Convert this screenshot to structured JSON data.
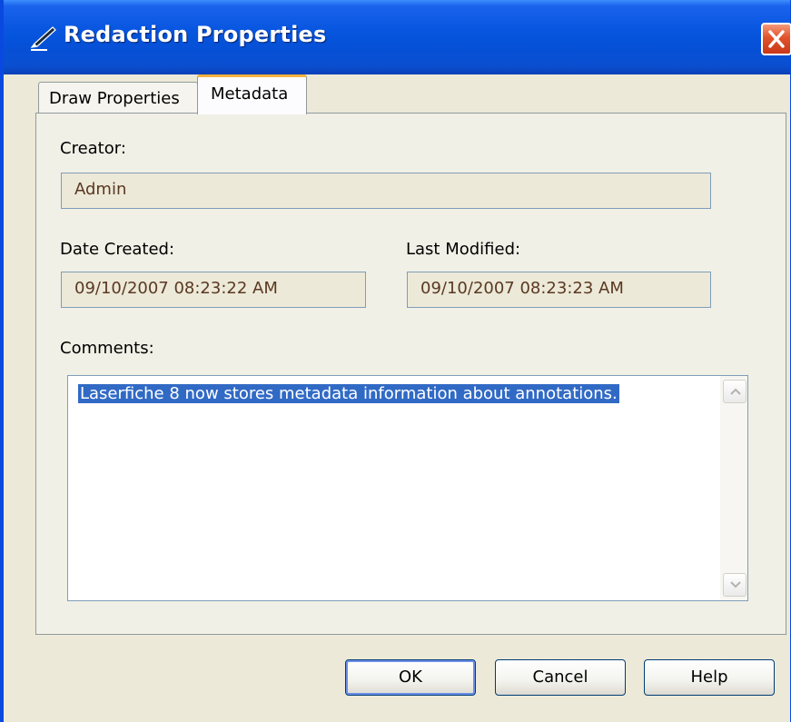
{
  "window": {
    "title": "Redaction Properties",
    "icons": {
      "title": "pen-icon",
      "close": "close-x-icon"
    }
  },
  "tabs": [
    {
      "label": "Draw Properties",
      "active": false
    },
    {
      "label": "Metadata",
      "active": true
    }
  ],
  "metadata": {
    "creator_label": "Creator:",
    "creator_value": "Admin",
    "date_created_label": "Date Created:",
    "date_created_value": "09/10/2007 08:23:22 AM",
    "last_modified_label": "Last Modified:",
    "last_modified_value": "09/10/2007 08:23:23 AM",
    "comments_label": "Comments:",
    "comments_value": "Laserfiche 8 now stores metadata information about annotations."
  },
  "buttons": {
    "ok": "OK",
    "cancel": "Cancel",
    "help": "Help"
  },
  "colors": {
    "titlebar": "#0551d8",
    "close_button": "#e2532a",
    "active_tab_accent": "#f7b23e",
    "selection": "#316ac5",
    "dialog_bg": "#ece9d8"
  }
}
